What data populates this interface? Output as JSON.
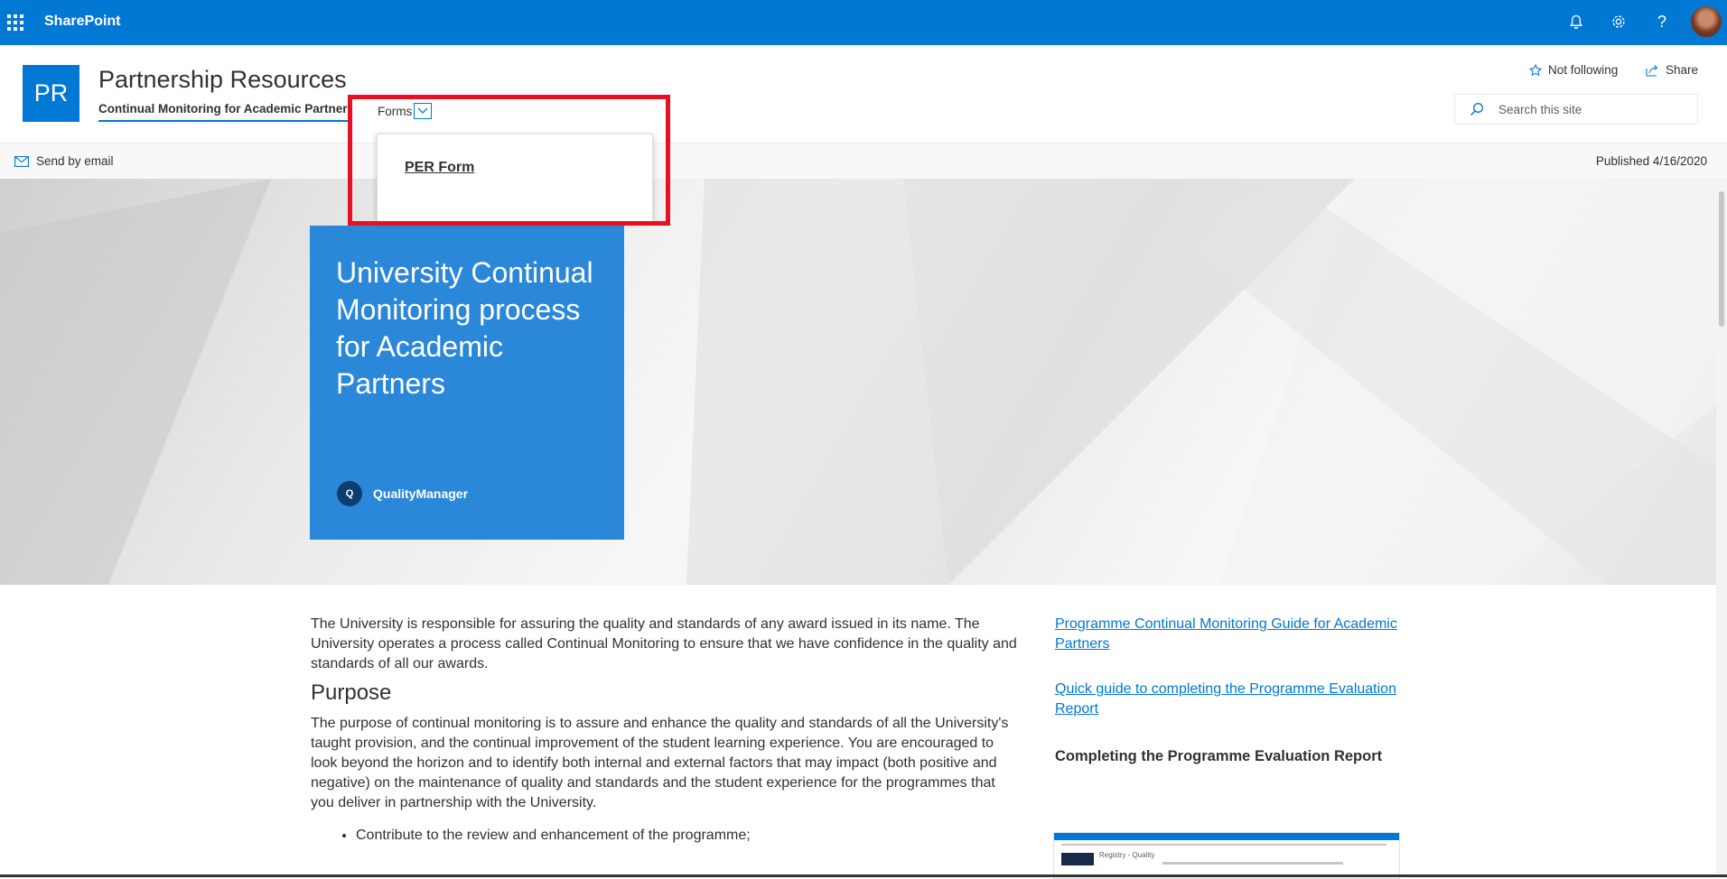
{
  "suitebar": {
    "brand": "SharePoint",
    "icons": [
      "waffle-icon",
      "bell-icon",
      "gear-icon",
      "help-icon"
    ]
  },
  "site": {
    "logo": "PR",
    "title": "Partnership Resources",
    "nav_current": "Continual Monitoring for Academic Partners",
    "nav_forms": "Forms",
    "follow": "Not following",
    "share": "Share",
    "search_placeholder": "Search this site"
  },
  "commandbar": {
    "send_email": "Send by email",
    "published": "Published 4/16/2020"
  },
  "hero": {
    "title": "University Continual Monitoring process for Academic Partners",
    "author_initial": "Q",
    "author": "QualityManager"
  },
  "dropdown": {
    "items": [
      "PER Form"
    ]
  },
  "content": {
    "intro": "The University is responsible for assuring the quality and standards of any award issued in its name. The University operates a process called Continual Monitoring to ensure that we have confidence in the quality and standards of all our awards.",
    "purpose_heading": "Purpose",
    "purpose_text": "The purpose of continual monitoring is to assure and enhance the quality and standards of all the University's taught provision, and the continual improvement of the student learning experience. You are encouraged to look beyond the horizon and to identify both internal and external factors that may impact (both positive and negative) on the maintenance of quality and standards and the student experience for the programmes that you deliver in partnership with the University.",
    "bullets": [
      "Contribute to the review and enhancement of the programme;"
    ]
  },
  "sidebar": {
    "link1": "Programme Continual Monitoring Guide for Academic Partners",
    "link2": "Quick guide to completing the Programme Evaluation Report",
    "heading": "Completing the Programme Evaluation Report",
    "thumb_title": "Registry - Quality"
  },
  "colors": {
    "accent": "#0078d4",
    "hero_card": "#2b88d8",
    "highlight": "#e81123"
  }
}
